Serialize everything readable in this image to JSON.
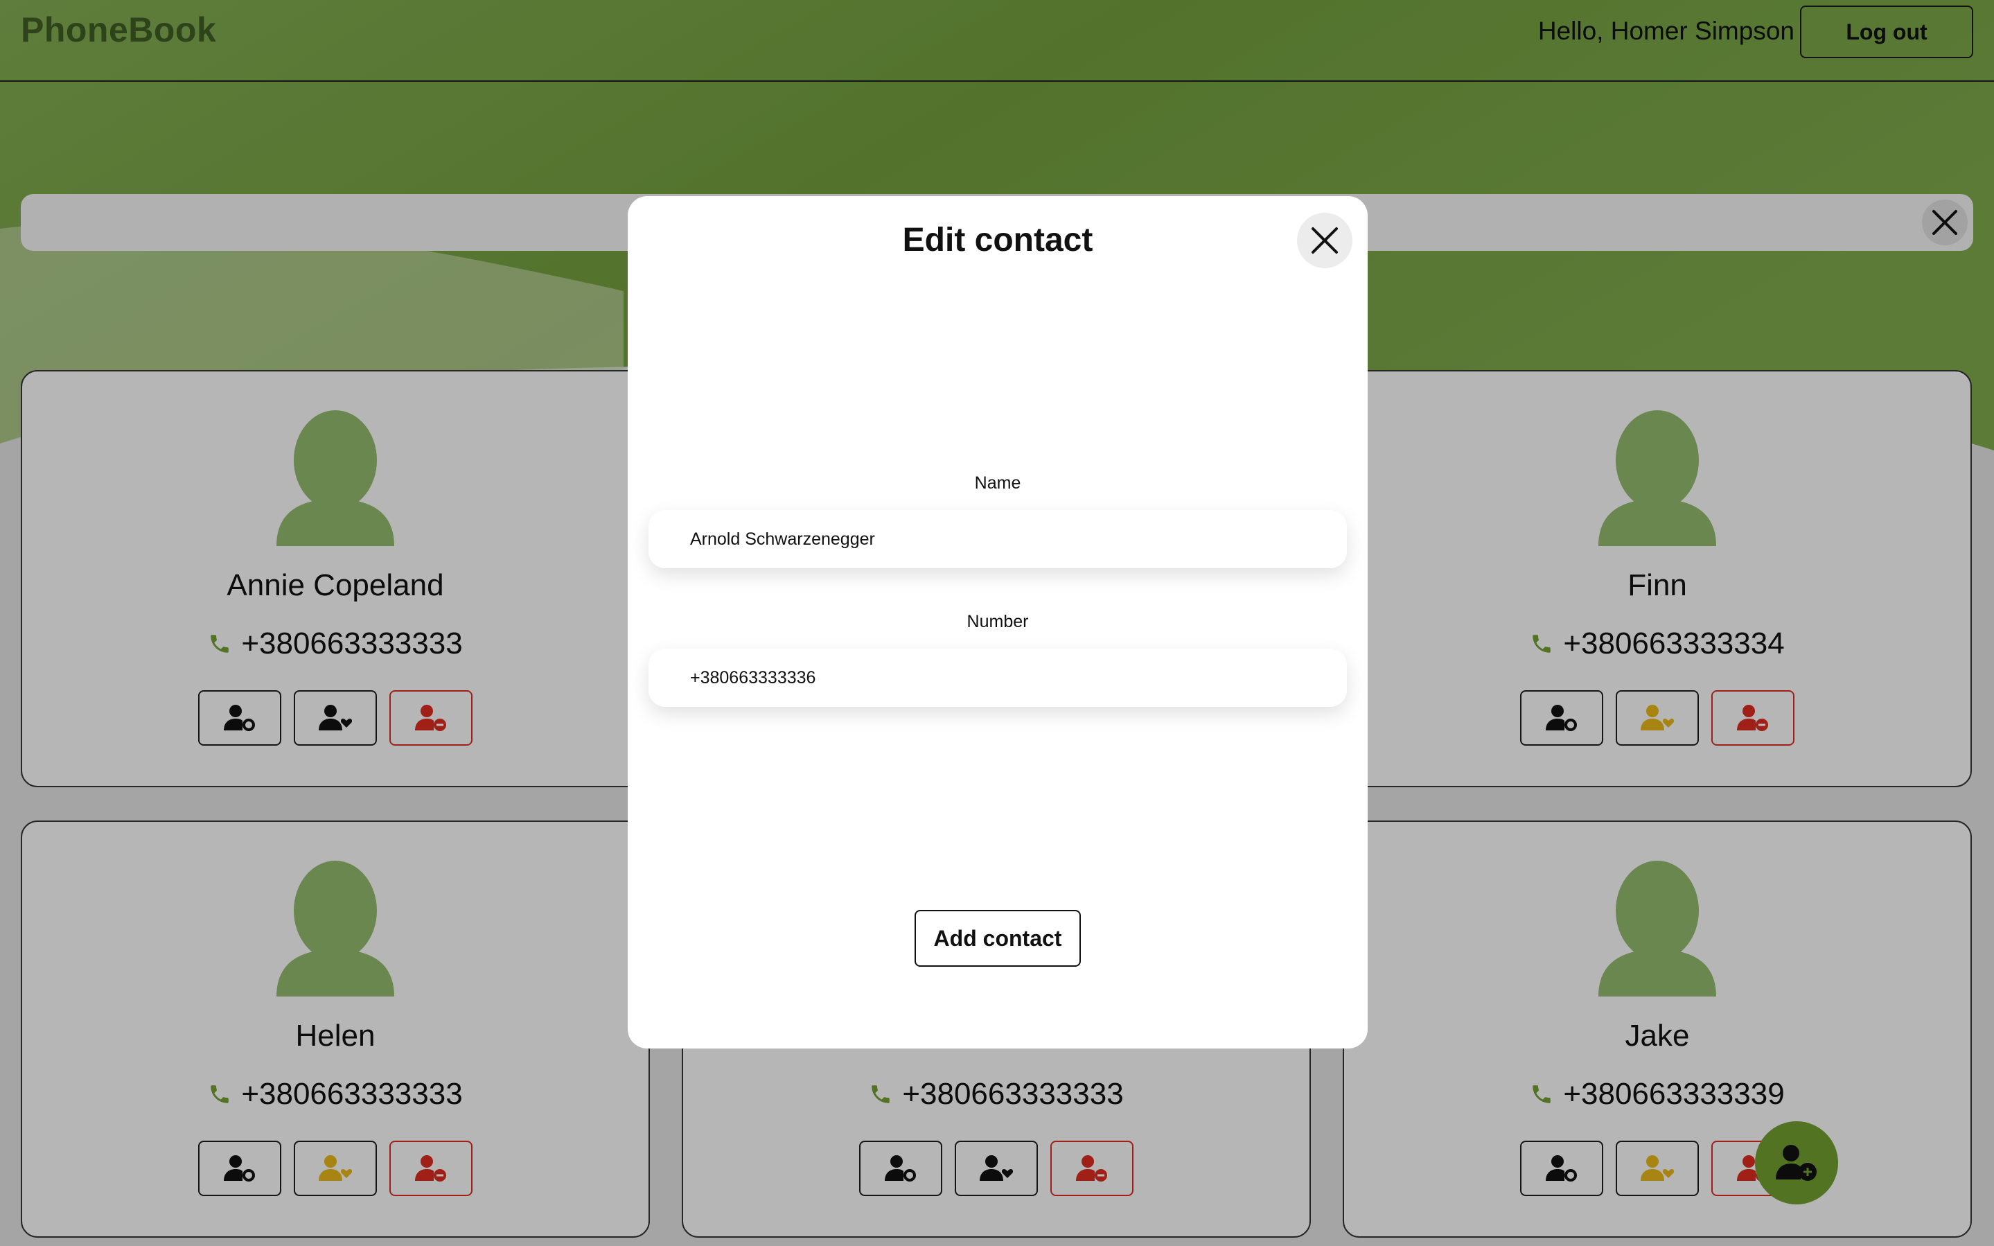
{
  "header": {
    "logo": "PhoneBook",
    "greeting": "Hello, Homer Simpson",
    "logout_label": "Log out"
  },
  "search": {
    "placeholder": "",
    "value": ""
  },
  "contacts": [
    {
      "name": "Annie Copeland",
      "number": "+380663333333",
      "favorite": false
    },
    {
      "name": "Finn",
      "number": "+380663333334",
      "favorite": true
    },
    {
      "name": "Helen",
      "number": "+380663333333",
      "favorite": true
    },
    {
      "name": "",
      "number": "+380663333333",
      "favorite": false
    },
    {
      "name": "Jake",
      "number": "+380663333339",
      "favorite": true
    }
  ],
  "modal": {
    "title": "Edit contact",
    "name_label": "Name",
    "name_value": "Arnold Schwarzenegger",
    "number_label": "Number",
    "number_value": "+380663333336",
    "submit_label": "Add contact"
  },
  "icons": {
    "close": "close-icon",
    "phone": "phone-icon",
    "edit": "user-gear-icon",
    "favorite": "user-heart-icon",
    "delete": "user-minus-icon",
    "add": "user-plus-icon",
    "avatar": "avatar-icon"
  },
  "colors": {
    "brand_green": "#6c9a2e",
    "avatar_green": "#8db46a",
    "favorite_active": "#e0b21a",
    "delete_red": "#d62a1f",
    "text_dark": "#111111"
  }
}
